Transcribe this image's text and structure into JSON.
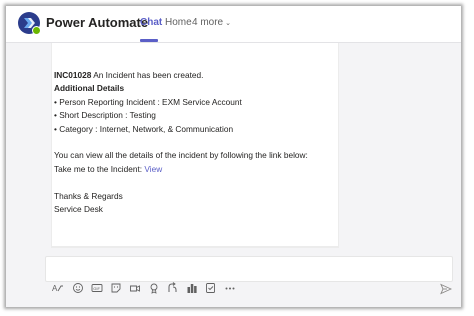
{
  "header": {
    "app_title": "Power Automate",
    "tabs": [
      {
        "label": "Chat",
        "active": true
      },
      {
        "label": "Home",
        "active": false
      },
      {
        "label": "4 more",
        "active": false
      }
    ]
  },
  "message": {
    "incident_id": "INC01028",
    "created_text": " An Incident has been created.",
    "details_heading": "Additional Details",
    "bullets": [
      "• Person Reporting Incident : EXM Service Account",
      "• Short Description : Testing",
      "• Category : Internet, Network, & Communication"
    ],
    "view_text": "You can view all the details of the incident by following the link below:",
    "take_me_text": "Take me to the Incident: ",
    "link_label": "View",
    "signoff": "Thanks & Regards",
    "signature": "Service Desk"
  },
  "compose": {
    "toolbar_icons": [
      "format-icon",
      "emoji-icon",
      "gif-icon",
      "sticker-icon",
      "schedule-meeting-icon",
      "praise-icon",
      "loop-icon",
      "stream-icon",
      "approvals-icon",
      "more-icon"
    ]
  },
  "colors": {
    "accent": "#5b5fc7",
    "presence": "#6bb700"
  }
}
